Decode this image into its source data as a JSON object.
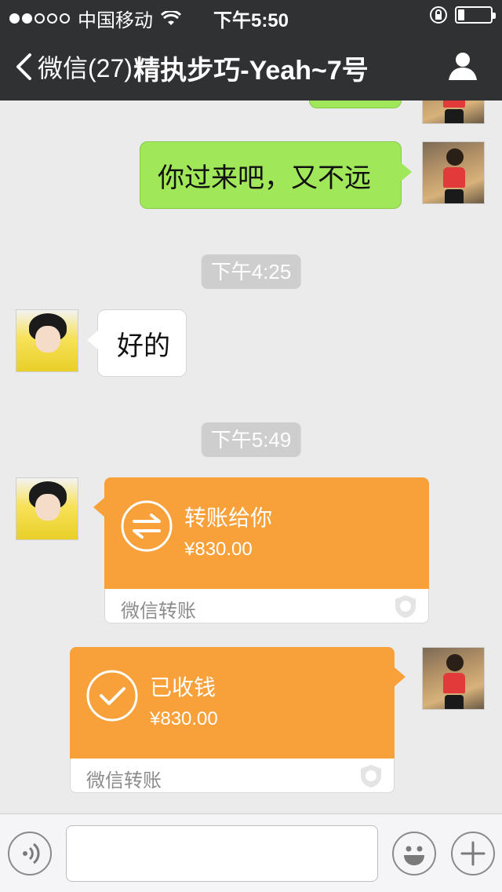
{
  "status_bar": {
    "carrier": "中国移动",
    "time": "下午5:50",
    "battery_level": 0.2
  },
  "nav": {
    "back_label": "微信(27)",
    "title": "精执步巧-Yeah~7号"
  },
  "messages": {
    "m1": {
      "text": "你过来吧，又不远"
    },
    "t1": {
      "text": "下午4:25"
    },
    "m2": {
      "text": "好的"
    },
    "t2": {
      "text": "下午5:49"
    },
    "transfer1": {
      "label": "转账给你",
      "amount": "¥830.00",
      "source": "微信转账"
    },
    "transfer2": {
      "label": "已收钱",
      "amount": "¥830.00",
      "source": "微信转账"
    }
  },
  "input": {
    "placeholder": ""
  },
  "colors": {
    "nav_bg": "#2f3133",
    "chat_bg": "#ebebeb",
    "bubble_green": "#a0e75a",
    "transfer_orange": "#f8a13a"
  },
  "icons": [
    "wifi-icon",
    "rotation-lock-icon",
    "battery-icon",
    "chevron-left-icon",
    "person-icon",
    "transfer-arrows-icon",
    "check-icon",
    "shield-icon",
    "voice-icon",
    "emoji-icon",
    "plus-icon"
  ]
}
